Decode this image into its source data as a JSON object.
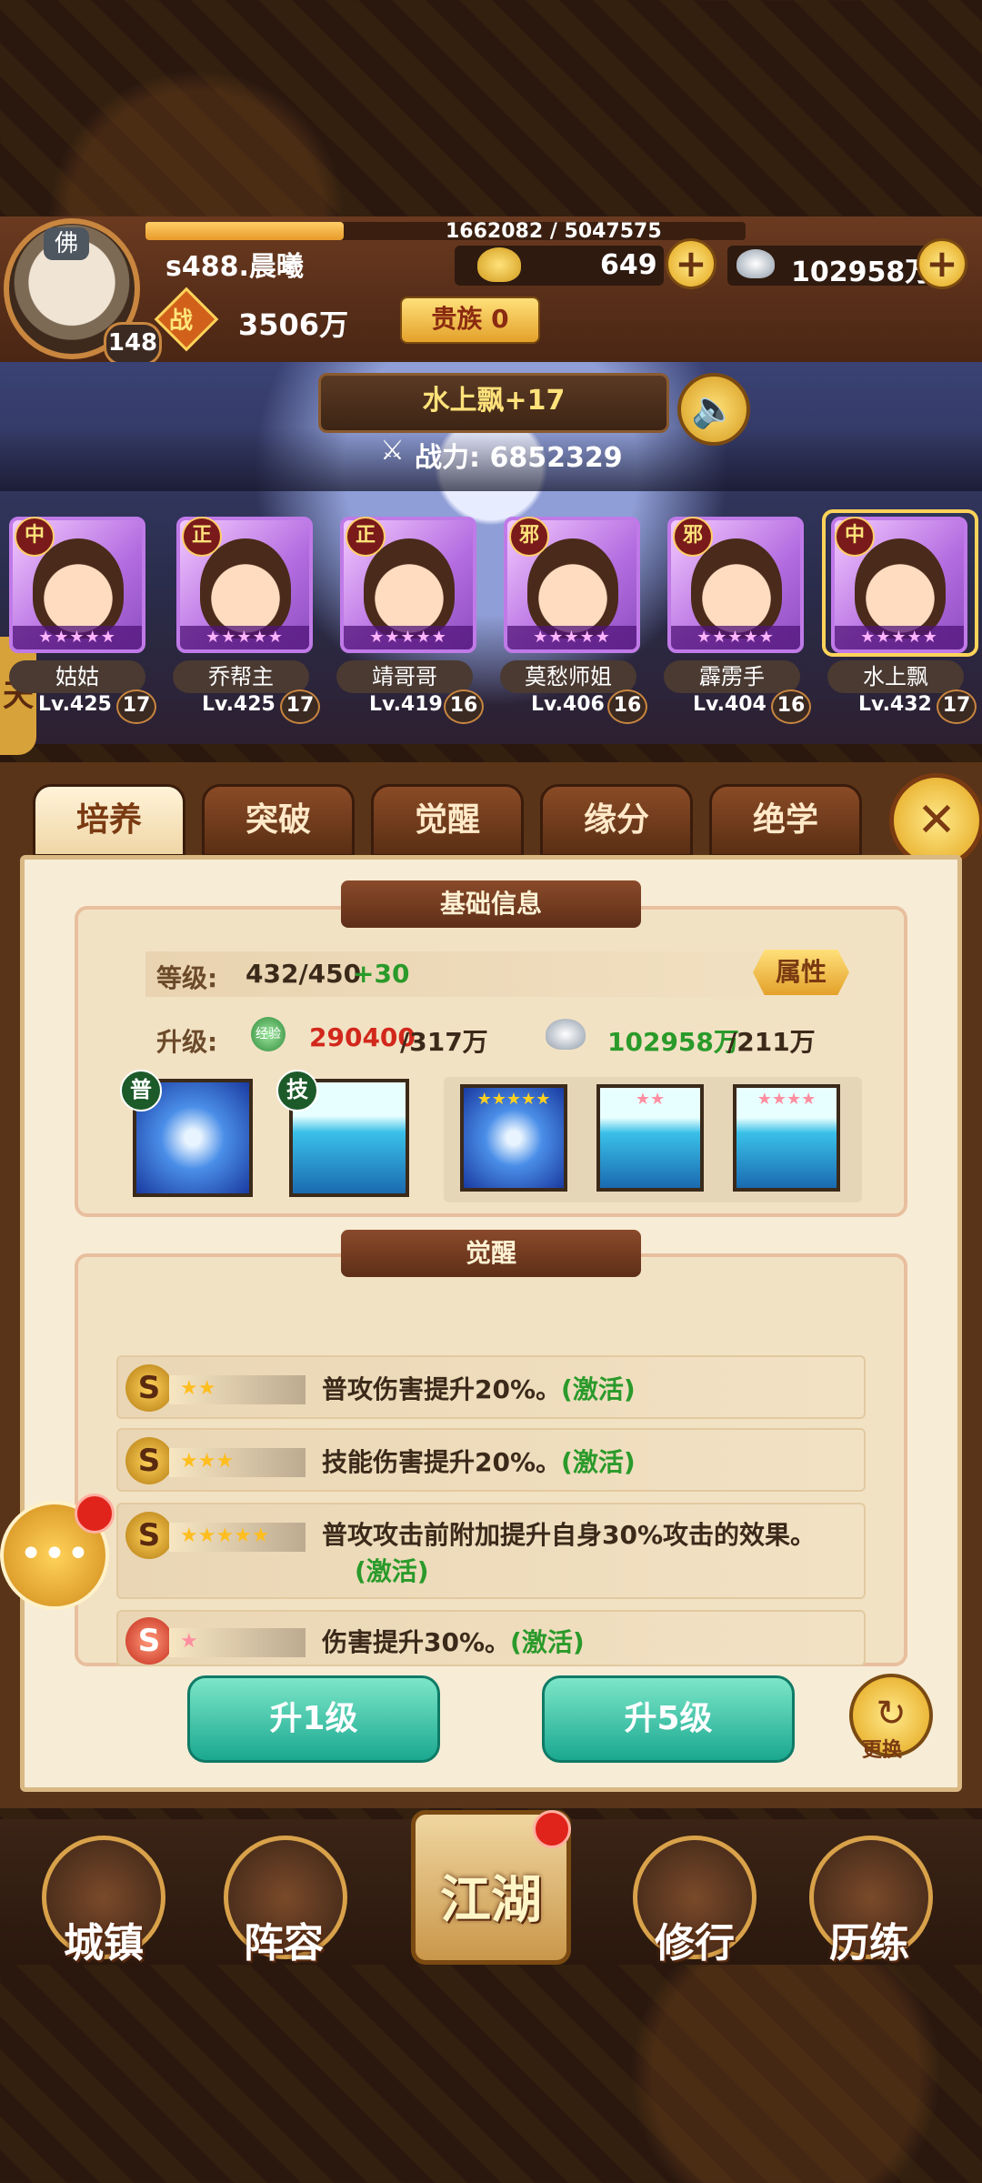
{
  "header": {
    "avatar_badge": "佛",
    "level": "148",
    "exp_text": "1662082 / 5047575",
    "exp_fraction": 0.33,
    "player_name": "s488.晨曦",
    "gold": "649",
    "silver": "102958万",
    "zhan_label": "战",
    "power": "3506万",
    "noble": "贵族 0"
  },
  "stage": {
    "hero_title": "水上飘+17",
    "power_label": "战力:",
    "power_value": "6852329"
  },
  "heroes": [
    {
      "name": "姑姑",
      "align": "中",
      "lv": "Lv.425",
      "grade": "17"
    },
    {
      "name": "乔帮主",
      "align": "正",
      "lv": "Lv.425",
      "grade": "17"
    },
    {
      "name": "靖哥哥",
      "align": "正",
      "lv": "Lv.419",
      "grade": "16"
    },
    {
      "name": "莫愁师姐",
      "align": "邪",
      "lv": "Lv.406",
      "grade": "16"
    },
    {
      "name": "霹雳手",
      "align": "邪",
      "lv": "Lv.404",
      "grade": "16"
    },
    {
      "name": "水上飘",
      "align": "中",
      "lv": "Lv.432",
      "grade": "17"
    }
  ],
  "tabs": [
    "培养",
    "突破",
    "觉醒",
    "缘分",
    "绝学"
  ],
  "basic": {
    "title": "基础信息",
    "level_label": "等级:",
    "level_value": "432/450",
    "level_bonus": "+30",
    "attr_button": "属性",
    "upgrade_label": "升级:",
    "exp_icon_text": "经验",
    "exp_have": "290400",
    "exp_need": "/317万",
    "silver_have": "102958万",
    "silver_need": "/211万",
    "skill_tags": [
      "普",
      "技"
    ],
    "upgrade_stars": [
      "★★★★★",
      "★★",
      "★★★★"
    ]
  },
  "awaken": {
    "title": "觉醒",
    "items": [
      {
        "stars": "★★",
        "text": "普攻伤害提升20%。",
        "status": "(激活)"
      },
      {
        "stars": "★★★",
        "text": "技能伤害提升20%。",
        "status": "(激活)"
      },
      {
        "stars": "★★★★★",
        "text": "普攻攻击前附加提升自身30%攻击的效果。",
        "status": "(激活)"
      },
      {
        "stars": "★",
        "text": "伤害提升30%。",
        "status": "(激活)"
      }
    ]
  },
  "actions": {
    "up1": "升1级",
    "up5": "升5级",
    "swap": "更换"
  },
  "nav": [
    "城镇",
    "阵容",
    "江湖",
    "修行",
    "历练"
  ]
}
